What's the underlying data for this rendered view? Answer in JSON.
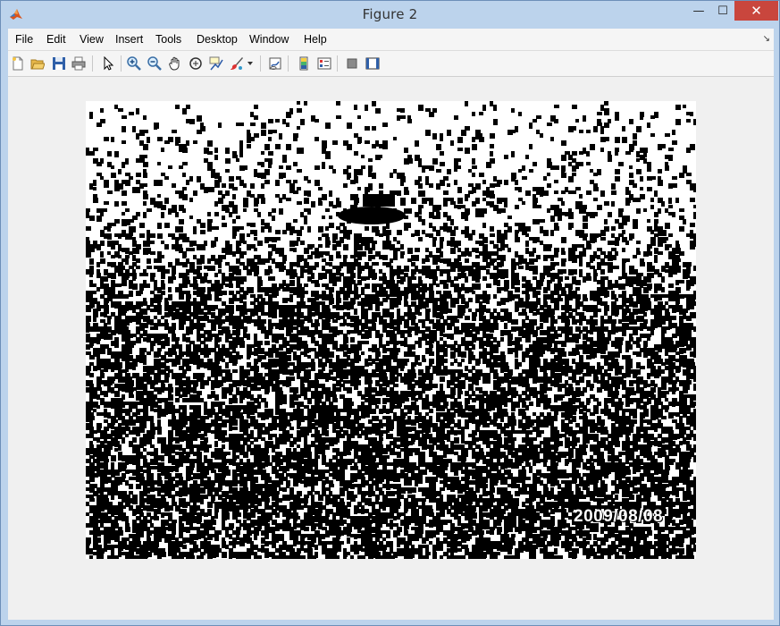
{
  "window": {
    "title": "Figure 2"
  },
  "window_controls": {
    "minimize": "—",
    "maximize": "☐",
    "close": "✕"
  },
  "menubar": {
    "items": [
      "File",
      "Edit",
      "View",
      "Insert",
      "Tools",
      "Desktop",
      "Window",
      "Help"
    ],
    "dock_arrow": "↘"
  },
  "toolbar": {
    "icons": [
      "new-figure-icon",
      "open-file-icon",
      "save-icon",
      "print-icon",
      "edit-plot-arrow-icon",
      "zoom-in-icon",
      "zoom-out-icon",
      "pan-hand-icon",
      "rotate-3d-icon",
      "data-cursor-icon",
      "brush-icon",
      "brush-dropdown-icon",
      "link-plot-icon",
      "colorbar-icon",
      "legend-icon",
      "hide-plot-tools-icon",
      "show-plot-tools-icon"
    ]
  },
  "figure": {
    "timestamp": "2009/08/08"
  },
  "colors": {
    "titlebar": "#bcd3ec",
    "close": "#c9463d",
    "canvas": "#f0f0f0"
  }
}
